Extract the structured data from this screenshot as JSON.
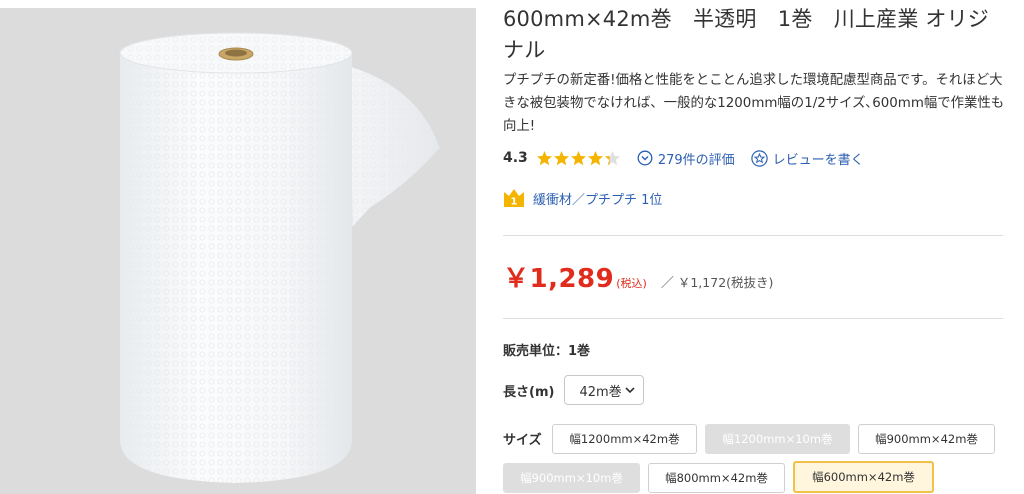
{
  "product": {
    "title": "600mm×42m巻　半透明　1巻　川上産業 オリジ\nナル",
    "description": "プチプチの新定番!価格と性能をとことん追求した環境配慮型商品です。それほど大きな被包装物でなければ、一般的な1200mm幅の1/2サイズ､600mm幅で作業性も向上!",
    "image_icon": "bubble-wrap-roll"
  },
  "rating": {
    "score": "4.3",
    "stars_value": 4.3,
    "stars_max": 5,
    "star_color": "#f5b400",
    "reviews_link": "279件の評価",
    "write_review": "レビューを書く"
  },
  "ranking": {
    "badge": "1",
    "text": "緩衝材／プチプチ 1位"
  },
  "price": {
    "main": "￥1,289",
    "tax_label": "(税込)",
    "separator": "／",
    "without_tax": "￥1,172(税抜き)",
    "color": "#e02b1d"
  },
  "sales_unit": "販売単位：1巻",
  "length": {
    "label": "長さ(m)",
    "selected": "42m巻"
  },
  "size": {
    "label": "サイズ",
    "options": [
      {
        "label": "幅1200mm×42m巻",
        "state": "available"
      },
      {
        "label": "幅1200mm×10m巻",
        "state": "disabled"
      },
      {
        "label": "幅900mm×42m巻",
        "state": "available"
      },
      {
        "label": "幅900mm×10m巻",
        "state": "disabled"
      },
      {
        "label": "幅800mm×42m巻",
        "state": "available"
      },
      {
        "label": "幅600mm×42m巻",
        "state": "selected"
      }
    ]
  },
  "colors": {
    "link": "#2b5fb3",
    "selected_border": "#f2c14a",
    "badge": "#f5b400"
  }
}
